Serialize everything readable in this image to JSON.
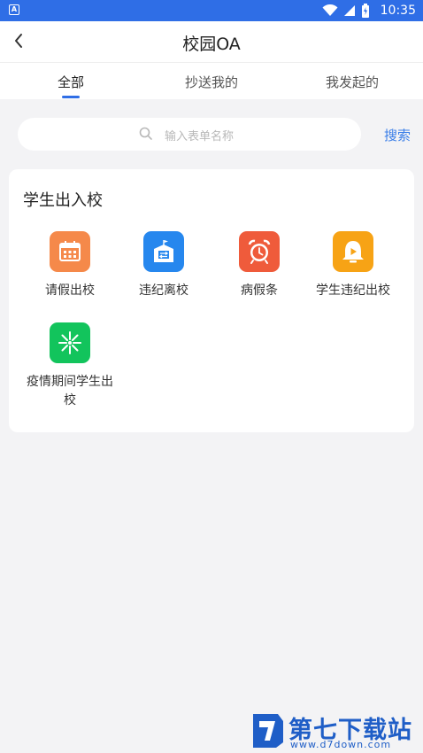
{
  "status_bar": {
    "time": "10:35",
    "app_badge": "A"
  },
  "header": {
    "title": "校园OA"
  },
  "tabs": [
    {
      "label": "全部",
      "active": true
    },
    {
      "label": "抄送我的",
      "active": false
    },
    {
      "label": "我发起的",
      "active": false
    }
  ],
  "search": {
    "placeholder": "输入表单名称",
    "button_label": "搜索"
  },
  "section": {
    "title": "学生出入校",
    "apps": [
      {
        "label": "请假出校",
        "icon": "calendar-icon",
        "color": "#f5894a"
      },
      {
        "label": "违纪离校",
        "icon": "school-building-icon",
        "color": "#2687ee"
      },
      {
        "label": "病假条",
        "icon": "alarm-clock-icon",
        "color": "#ef5b3b"
      },
      {
        "label": "学生违纪出校",
        "icon": "bell-play-icon",
        "color": "#f7a315"
      },
      {
        "label": "疫情期间学生出校",
        "icon": "sparkle-icon",
        "color": "#12c45c"
      }
    ]
  },
  "colors": {
    "accent": "#2f6ee6",
    "link": "#3a7ee8",
    "background": "#f3f3f5"
  },
  "watermark": {
    "name": "第七下载站",
    "url": "www.d7down.com"
  }
}
